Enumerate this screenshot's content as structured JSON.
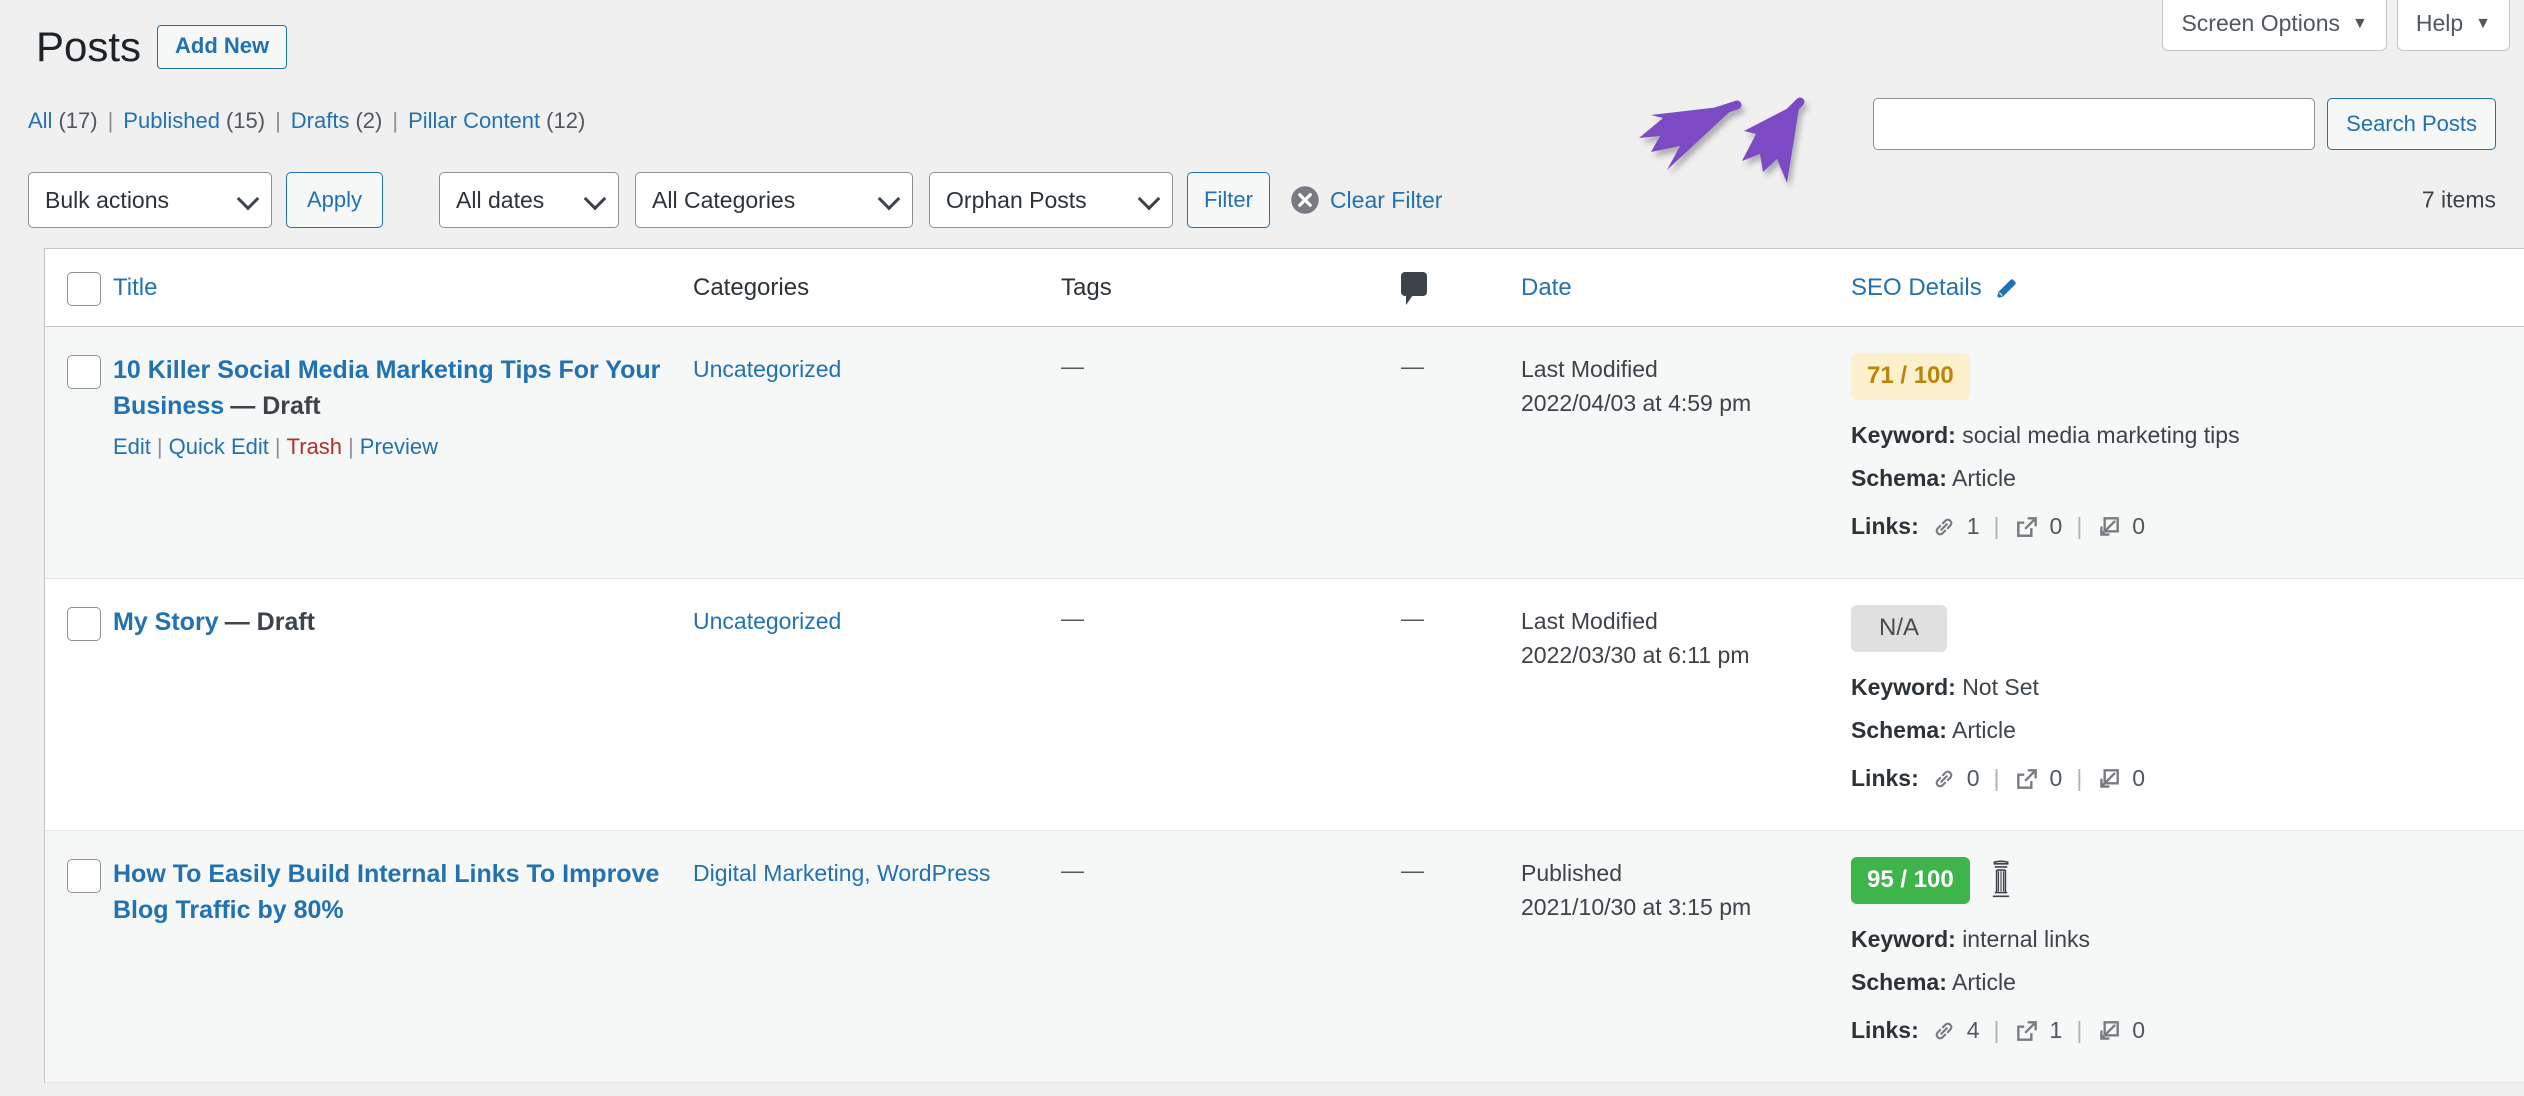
{
  "screen_meta": {
    "screen_options": "Screen Options",
    "help": "Help"
  },
  "header": {
    "page_title": "Posts",
    "add_new": "Add New"
  },
  "status_links": [
    {
      "label": "All",
      "count": "(17)"
    },
    {
      "label": "Published",
      "count": "(15)"
    },
    {
      "label": "Drafts",
      "count": "(2)"
    },
    {
      "label": "Pillar Content",
      "count": "(12)"
    }
  ],
  "search": {
    "value": "",
    "placeholder": "",
    "button": "Search Posts"
  },
  "filters": {
    "bulk_actions": "Bulk actions",
    "apply": "Apply",
    "all_dates": "All dates",
    "all_categories": "All Categories",
    "orphan_posts": "Orphan Posts",
    "filter": "Filter",
    "clear_filter": "Clear Filter",
    "items_count": "7 items"
  },
  "table": {
    "columns": {
      "title": "Title",
      "categories": "Categories",
      "tags": "Tags",
      "comments": "",
      "date": "Date",
      "seo_details": "SEO Details"
    },
    "rows": [
      {
        "title": "10 Killer Social Media Marketing Tips For Your Business",
        "state": "— Draft",
        "actions": {
          "edit": "Edit",
          "quick_edit": "Quick Edit",
          "trash": "Trash",
          "preview": "Preview"
        },
        "categories": "Uncategorized",
        "tags": "—",
        "comments": "—",
        "date_status": "Last Modified",
        "date_value": "2022/04/03 at 4:59 pm",
        "score": "71 / 100",
        "score_kind": "yellow",
        "pillar": false,
        "keyword_label": "Keyword:",
        "keyword_value": "social media marketing tips",
        "schema_label": "Schema:",
        "schema_value": "Article",
        "links_label": "Links:",
        "links_internal": "1",
        "links_external": "0",
        "links_inbound": "0"
      },
      {
        "title": "My Story",
        "state": "— Draft",
        "actions": null,
        "categories": "Uncategorized",
        "tags": "—",
        "comments": "—",
        "date_status": "Last Modified",
        "date_value": "2022/03/30 at 6:11 pm",
        "score": "N/A",
        "score_kind": "gray",
        "pillar": false,
        "keyword_label": "Keyword:",
        "keyword_value": "Not Set",
        "schema_label": "Schema:",
        "schema_value": "Article",
        "links_label": "Links:",
        "links_internal": "0",
        "links_external": "0",
        "links_inbound": "0"
      },
      {
        "title": "How To Easily Build Internal Links To Improve Blog Traffic by 80%",
        "state": "",
        "actions": null,
        "categories": "Digital Marketing, WordPress",
        "tags": "—",
        "comments": "—",
        "date_status": "Published",
        "date_value": "2021/10/30 at 3:15 pm",
        "score": "95 / 100",
        "score_kind": "green",
        "pillar": true,
        "keyword_label": "Keyword:",
        "keyword_value": "internal links",
        "schema_label": "Schema:",
        "schema_value": "Article",
        "links_label": "Links:",
        "links_internal": "4",
        "links_external": "1",
        "links_inbound": "0"
      }
    ]
  },
  "annotations": {
    "arrow_color": "#7b4cc4",
    "arrow_count": 2
  }
}
